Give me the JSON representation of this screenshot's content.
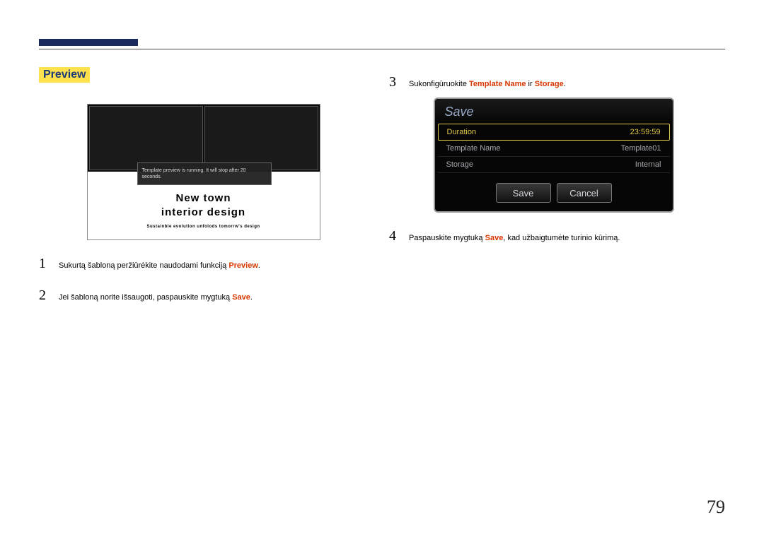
{
  "heading": "Preview",
  "preview": {
    "tooltip": "Template preview is running. It will stop after 20 seconds.",
    "title_line1": "New  town",
    "title_line2": "interior  design",
    "subtitle": "Sustainble evolution  unfolods tomorrw's design"
  },
  "left_steps": {
    "s1": {
      "num": "1",
      "text_a": "Sukurtą šabloną peržiūrėkite naudodami funkciją ",
      "hl": "Preview",
      "text_b": "."
    },
    "s2": {
      "num": "2",
      "text_a": "Jei šabloną norite išsaugoti, paspauskite mygtuką ",
      "hl": "Save",
      "text_b": "."
    }
  },
  "right_steps": {
    "s3": {
      "num": "3",
      "text_a": "Sukonfigūruokite ",
      "hl1": "Template Name",
      "mid": " ir ",
      "hl2": "Storage",
      "text_b": "."
    },
    "s4": {
      "num": "4",
      "text_a": "Paspauskite mygtuką ",
      "hl": "Save",
      "text_b": ", kad užbaigtumėte turinio kūrimą."
    }
  },
  "dialog": {
    "title": "Save",
    "rows": {
      "r1": {
        "label": "Duration",
        "value": "23:59:59"
      },
      "r2": {
        "label": "Template Name",
        "value": "Template01"
      },
      "r3": {
        "label": "Storage",
        "value": "Internal"
      }
    },
    "save_btn": "Save",
    "cancel_btn": "Cancel"
  },
  "page_number": "79"
}
